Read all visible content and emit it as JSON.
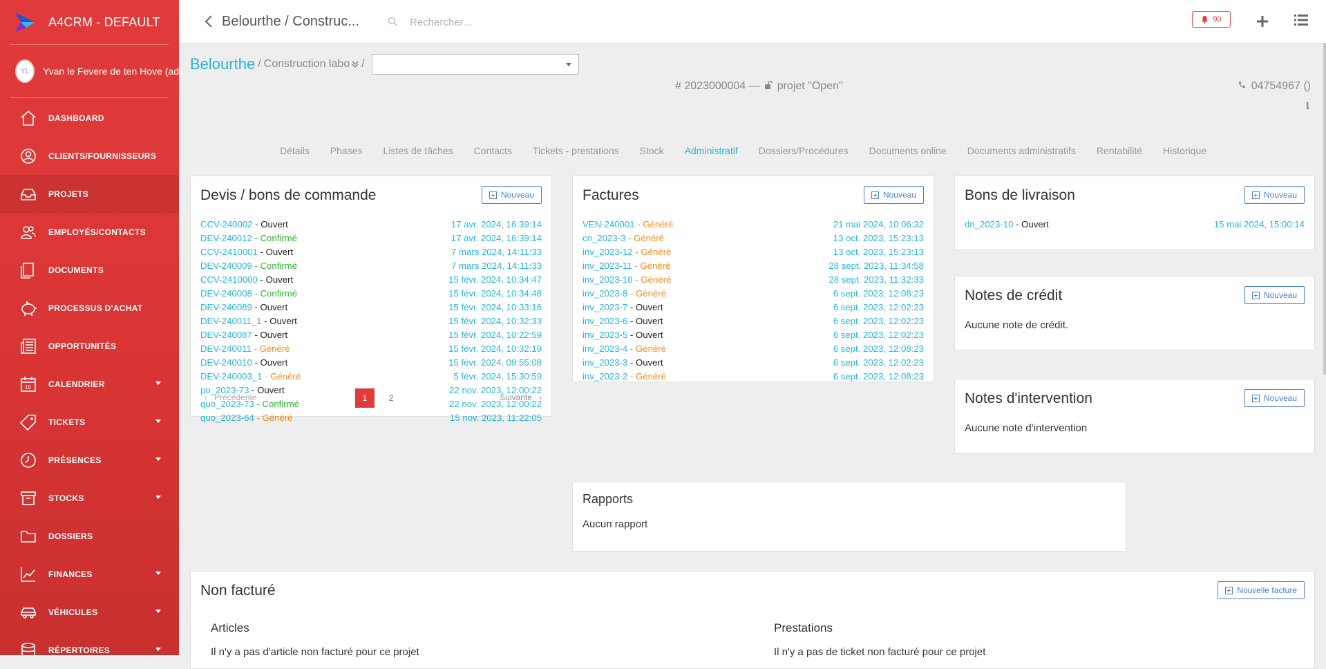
{
  "app": {
    "name": "A4CRM - DEFAULT"
  },
  "user": {
    "initials": "YL",
    "name": "Yvan le Fevere de ten Hove (ad"
  },
  "sidebar": {
    "items": [
      {
        "label": "DASHBOARD",
        "icon": "home-icon",
        "dropdown": false,
        "active": false
      },
      {
        "label": "CLIENTS/FOURNISSEURS",
        "icon": "user-circle-icon",
        "dropdown": false,
        "active": false
      },
      {
        "label": "PROJETS",
        "icon": "inbox-icon",
        "dropdown": false,
        "active": true
      },
      {
        "label": "EMPLOYÉS/CONTACTS",
        "icon": "users-icon",
        "dropdown": false,
        "active": false
      },
      {
        "label": "DOCUMENTS",
        "icon": "files-icon",
        "dropdown": false,
        "active": false
      },
      {
        "label": "PROCESSUS D'ACHAT",
        "icon": "piggy-bank-icon",
        "dropdown": false,
        "active": false
      },
      {
        "label": "OPPORTUNITÉS",
        "icon": "newspaper-icon",
        "dropdown": false,
        "active": false
      },
      {
        "label": "CALENDRIER",
        "icon": "calendar-icon",
        "dropdown": true,
        "active": false
      },
      {
        "label": "TICKETS",
        "icon": "tag-icon",
        "dropdown": true,
        "active": false
      },
      {
        "label": "PRÉSENCES",
        "icon": "clock-icon",
        "dropdown": true,
        "active": false
      },
      {
        "label": "STOCKS",
        "icon": "archive-icon",
        "dropdown": true,
        "active": false
      },
      {
        "label": "DOSSIERS",
        "icon": "folder-icon",
        "dropdown": false,
        "active": false
      },
      {
        "label": "FINANCES",
        "icon": "chart-line-icon",
        "dropdown": true,
        "active": false
      },
      {
        "label": "VÉHICULES",
        "icon": "car-icon",
        "dropdown": true,
        "active": false
      },
      {
        "label": "RÉPERTOIRES",
        "icon": "database-icon",
        "dropdown": true,
        "active": false
      }
    ]
  },
  "topbar": {
    "title": "Belourthe / Construc...",
    "search_placeholder": "Rechercher...",
    "notifications": "90"
  },
  "breadcrumb": {
    "client": "Belourthe",
    "sep1": "/",
    "project": "Construction labo",
    "sep2": "/",
    "select_value": ""
  },
  "project": {
    "number": "# 2023000004 —",
    "status": "projet \"Open\"",
    "phone": "04754967 ()"
  },
  "tabs": [
    {
      "label": "Détails",
      "active": false
    },
    {
      "label": "Phases",
      "active": false
    },
    {
      "label": "Listes de tâches",
      "active": false
    },
    {
      "label": "Contacts",
      "active": false
    },
    {
      "label": "Tickets - prestations",
      "active": false
    },
    {
      "label": "Stock",
      "active": false
    },
    {
      "label": "Administratif",
      "active": true
    },
    {
      "label": "Dossiers/Procédures",
      "active": false
    },
    {
      "label": "Documents online",
      "active": false
    },
    {
      "label": "Documents administratifs",
      "active": false
    },
    {
      "label": "Rentabilité",
      "active": false
    },
    {
      "label": "Historique",
      "active": false
    }
  ],
  "devis": {
    "title": "Devis / bons de commande",
    "new_label": "Nouveau",
    "rows": [
      {
        "ref": "CCV-240002",
        "status": "Ouvert",
        "kind": "open",
        "date": "17 avr. 2024, 16:39:14"
      },
      {
        "ref": "DEV-240012",
        "status": "Confirmé",
        "kind": "conf",
        "date": "17 avr. 2024, 16:39:14"
      },
      {
        "ref": "CCV-2410001",
        "status": "Ouvert",
        "kind": "open",
        "date": "7 mars 2024, 14:11:33"
      },
      {
        "ref": "DEV-240009",
        "status": "Confirmé",
        "kind": "conf",
        "date": "7 mars 2024, 14:11:33"
      },
      {
        "ref": "CCV-2410000",
        "status": "Ouvert",
        "kind": "open",
        "date": "15 févr. 2024, 10:34:47"
      },
      {
        "ref": "DEV-240008",
        "status": "Confirmé",
        "kind": "conf",
        "date": "15 févr. 2024, 10:34:48"
      },
      {
        "ref": "DEV-240089",
        "status": "Ouvert",
        "kind": "open",
        "date": "15 févr. 2024, 10:33:16"
      },
      {
        "ref": "DEV-240011_1",
        "status": "Ouvert",
        "kind": "open",
        "date": "15 févr. 2024, 10:32:33"
      },
      {
        "ref": "DEV-240087",
        "status": "Ouvert",
        "kind": "open",
        "date": "15 févr. 2024, 10:22:59"
      },
      {
        "ref": "DEV-240011",
        "status": "Généré",
        "kind": "gen",
        "date": "15 févr. 2024, 10:32:19"
      },
      {
        "ref": "DEV-240010",
        "status": "Ouvert",
        "kind": "open",
        "date": "15 févr. 2024, 09:55:08"
      },
      {
        "ref": "DEV-240003_1",
        "status": "Généré",
        "kind": "gen",
        "date": "5 févr. 2024, 15:30:59"
      },
      {
        "ref": "po_2023-73",
        "status": "Ouvert",
        "kind": "open",
        "date": "22 nov. 2023, 12:00:22"
      },
      {
        "ref": "quo_2023-73",
        "status": "Confirmé",
        "kind": "conf",
        "date": "22 nov. 2023, 12:00:22"
      },
      {
        "ref": "quo_2023-64",
        "status": "Généré",
        "kind": "gen",
        "date": "15 nov. 2023, 11:22:05"
      }
    ],
    "pager": {
      "prev": "Précédente",
      "next": "Suivante",
      "pages": [
        "1",
        "2"
      ],
      "current": "1"
    }
  },
  "factures": {
    "title": "Factures",
    "new_label": "Nouveau",
    "rows": [
      {
        "ref": "VEN-240001",
        "status": "Généré",
        "kind": "gen",
        "date": "21 mai 2024, 10:06:32"
      },
      {
        "ref": "cn_2023-3",
        "status": "Généré",
        "kind": "gen",
        "date": "13 oct. 2023, 15:23:13"
      },
      {
        "ref": "inv_2023-12",
        "status": "Généré",
        "kind": "gen",
        "date": "13 oct. 2023, 15:23:13"
      },
      {
        "ref": "inv_2023-11",
        "status": "Généré",
        "kind": "gen",
        "date": "28 sept. 2023, 11:34:58"
      },
      {
        "ref": "inv_2023-10",
        "status": "Généré",
        "kind": "gen",
        "date": "28 sept. 2023, 11:32:33"
      },
      {
        "ref": "inv_2023-8",
        "status": "Généré",
        "kind": "gen",
        "date": "6 sept. 2023, 12:08:23"
      },
      {
        "ref": "inv_2023-7",
        "status": "Ouvert",
        "kind": "open",
        "date": "6 sept. 2023, 12:02:23"
      },
      {
        "ref": "inv_2023-6",
        "status": "Ouvert",
        "kind": "open",
        "date": "6 sept. 2023, 12:02:23"
      },
      {
        "ref": "inv_2023-5",
        "status": "Ouvert",
        "kind": "open",
        "date": "6 sept. 2023, 12:02:23"
      },
      {
        "ref": "inv_2023-4",
        "status": "Généré",
        "kind": "gen",
        "date": "6 sept. 2023, 12:08:23"
      },
      {
        "ref": "inv_2023-3",
        "status": "Ouvert",
        "kind": "open",
        "date": "6 sept. 2023, 12:02:23"
      },
      {
        "ref": "inv_2023-2",
        "status": "Généré",
        "kind": "gen",
        "date": "6 sept. 2023, 12:08:23"
      }
    ]
  },
  "livraison": {
    "title": "Bons de livraison",
    "new_label": "Nouveau",
    "rows": [
      {
        "ref": "dn_2023-10",
        "status": "Ouvert",
        "kind": "open",
        "date": "15 mai 2024, 15:00:14"
      }
    ]
  },
  "credit": {
    "title": "Notes de crédit",
    "new_label": "Nouveau",
    "empty": "Aucune note de crédit."
  },
  "intervention": {
    "title": "Notes d'intervention",
    "new_label": "Nouveau",
    "empty": "Aucune note d'intervention"
  },
  "rapports": {
    "title": "Rapports",
    "empty": "Aucun rapport"
  },
  "nonfacture": {
    "title": "Non facturé",
    "new_label": "Nouvelle facture",
    "articles_title": "Articles",
    "articles_empty": "Il n'y a pas d'article non facturé pour ce projet",
    "prestations_title": "Prestations",
    "prestations_empty": "Il n'y a pas de ticket non facturé pour ce projet"
  },
  "colors": {
    "sidebar": "#e23a3a",
    "accent": "#26b5e0",
    "confirmed": "#2ab52a",
    "generated": "#f08c20",
    "button": "#4a80d8"
  }
}
